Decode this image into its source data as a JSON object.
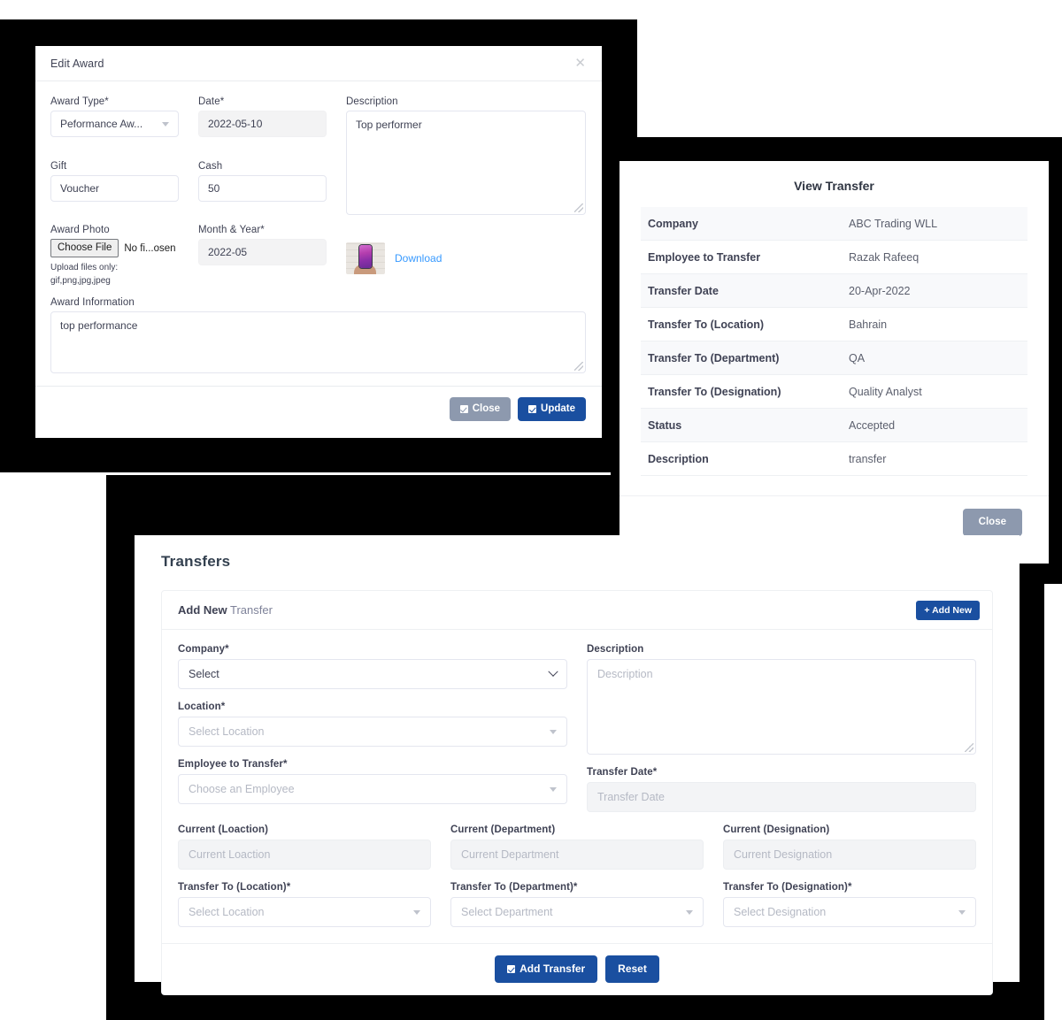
{
  "award_modal": {
    "title": "Edit Award",
    "close_icon": "close-icon",
    "fields": {
      "award_type_label": "Award Type*",
      "award_type_value": "Peformance Aw...",
      "date_label": "Date*",
      "date_value": "2022-05-10",
      "description_label": "Description",
      "description_value": "Top performer",
      "gift_label": "Gift",
      "gift_value": "Voucher",
      "cash_label": "Cash",
      "cash_value": "50",
      "award_photo_label": "Award Photo",
      "choose_file_label": "Choose File",
      "no_file_text": "No fi...osen",
      "upload_hint_line1": "Upload files only:",
      "upload_hint_line2": "gif,png,jpg,jpeg",
      "month_year_label": "Month & Year*",
      "month_year_value": "2022-05",
      "download_label": "Download",
      "award_information_label": "Award Information",
      "award_information_value": "top performance"
    },
    "footer": {
      "close_label": "Close",
      "update_label": "Update"
    }
  },
  "view_transfer": {
    "title": "View Transfer",
    "rows": [
      {
        "key": "Company",
        "value": "ABC Trading WLL"
      },
      {
        "key": "Employee to Transfer",
        "value": "Razak Rafeeq"
      },
      {
        "key": "Transfer Date",
        "value": "20-Apr-2022"
      },
      {
        "key": "Transfer To (Location)",
        "value": "Bahrain"
      },
      {
        "key": "Transfer To (Department)",
        "value": "QA"
      },
      {
        "key": "Transfer To (Designation)",
        "value": "Quality Analyst"
      },
      {
        "key": "Status",
        "value": "Accepted"
      },
      {
        "key": "Description",
        "value": "transfer"
      }
    ],
    "close_label": "Close"
  },
  "transfers_page": {
    "page_title": "Transfers",
    "card_title_bold": "Add New",
    "card_title_rest": " Transfer",
    "add_new_label": "+ Add New",
    "fields": {
      "company_label": "Company*",
      "company_value": "Select",
      "location_label": "Location*",
      "location_placeholder": "Select Location",
      "employee_label": "Employee to Transfer*",
      "employee_placeholder": "Choose an Employee",
      "description_label": "Description",
      "description_placeholder": "Description",
      "transfer_date_label": "Transfer Date*",
      "transfer_date_placeholder": "Transfer Date",
      "current_location_label": "Current (Loaction)",
      "current_location_placeholder": "Current Loaction",
      "current_department_label": "Current (Department)",
      "current_department_placeholder": "Current Department",
      "current_designation_label": "Current (Designation)",
      "current_designation_placeholder": "Current Designation",
      "transfer_to_location_label": "Transfer To (Location)*",
      "transfer_to_location_placeholder": "Select Location",
      "transfer_to_department_label": "Transfer To (Department)*",
      "transfer_to_department_placeholder": "Select Department",
      "transfer_to_designation_label": "Transfer To (Designation)*",
      "transfer_to_designation_placeholder": "Select Designation"
    },
    "footer": {
      "add_transfer_label": "Add Transfer",
      "reset_label": "Reset"
    }
  },
  "colors": {
    "primary_blue": "#1a4fa0",
    "secondary_gray": "#8d99ae",
    "link_blue": "#3699ff",
    "backdrop": "#000000"
  }
}
